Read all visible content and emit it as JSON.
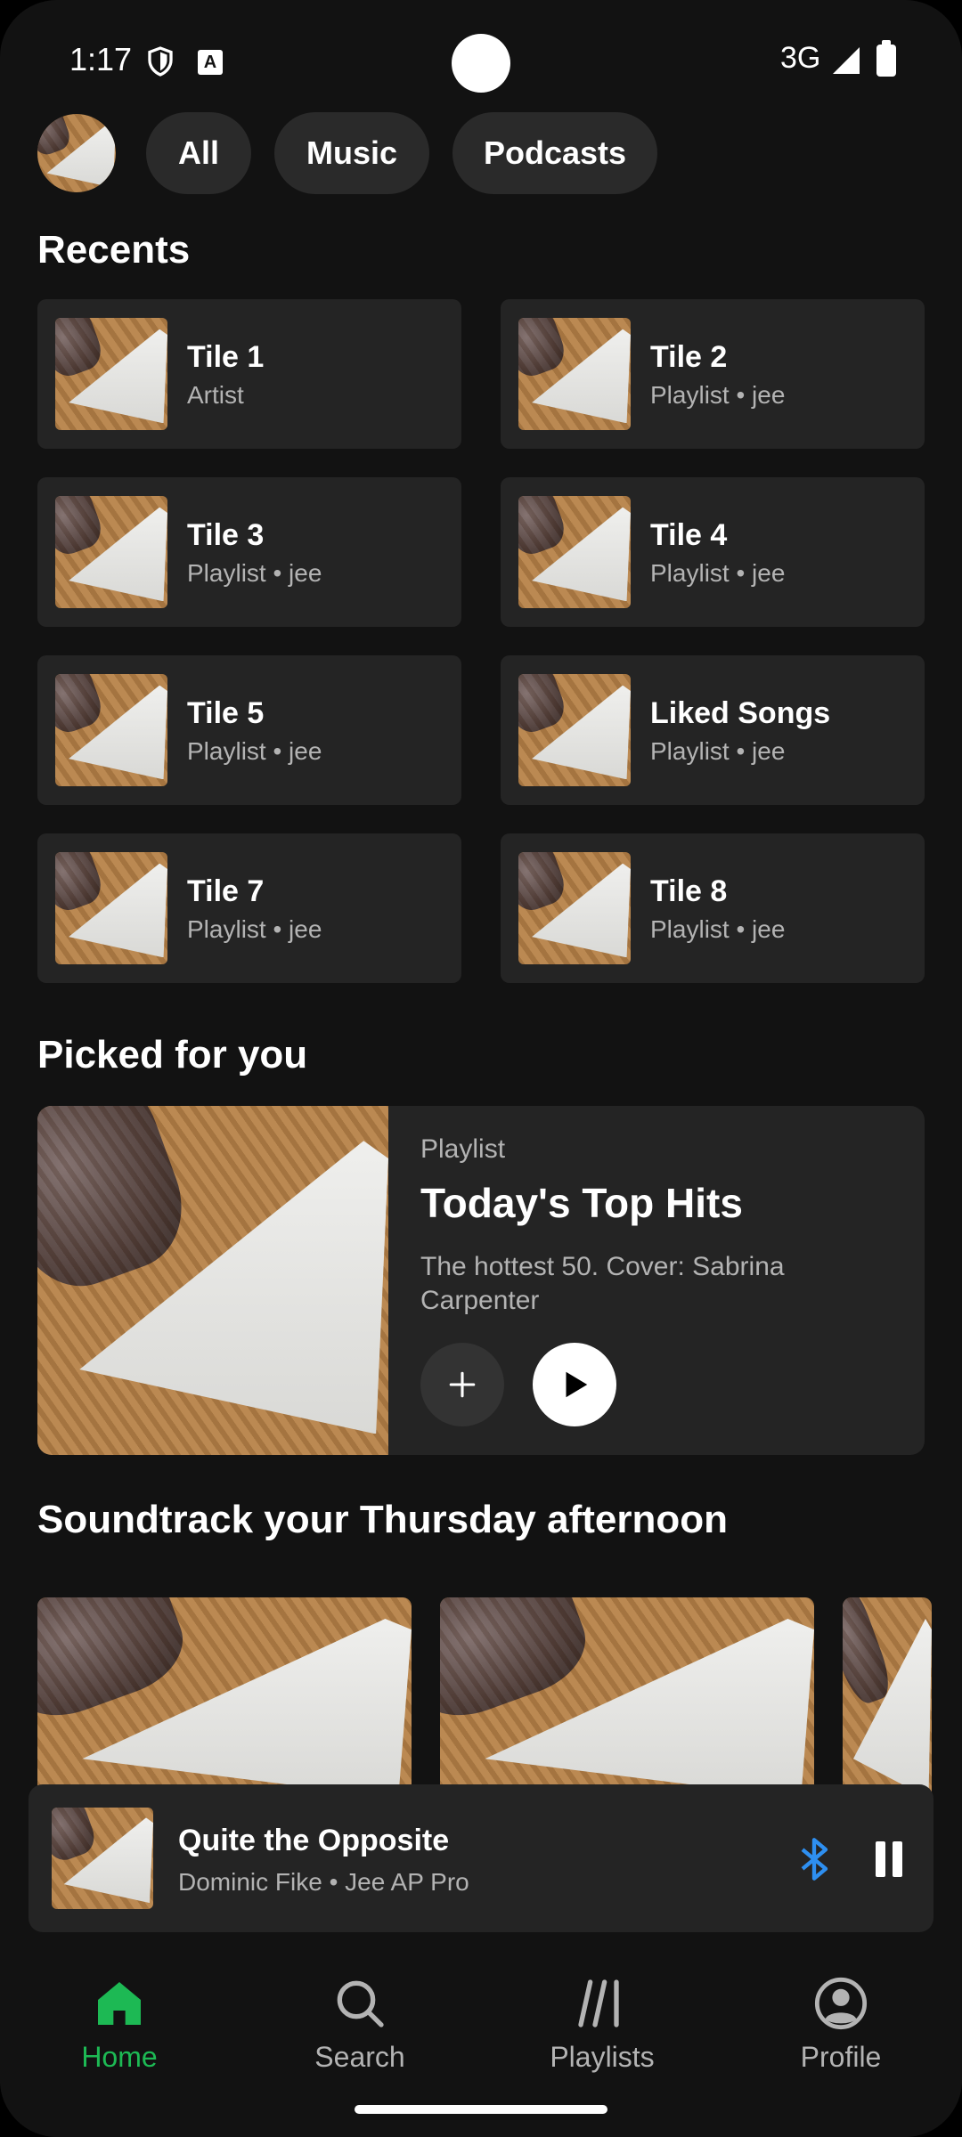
{
  "status_bar": {
    "time": "1:17",
    "network": "3G",
    "keyboard_badge": "A",
    "icons": [
      "shield-icon",
      "keyboard-a-icon",
      "cellular-signal-icon",
      "battery-icon"
    ]
  },
  "filters": {
    "chips": [
      {
        "label": "All"
      },
      {
        "label": "Music"
      },
      {
        "label": "Podcasts"
      }
    ]
  },
  "recents": {
    "title": "Recents",
    "tiles": [
      {
        "title": "Tile 1",
        "subtitle": "Artist"
      },
      {
        "title": "Tile 2",
        "subtitle": "Playlist • jee"
      },
      {
        "title": "Tile 3",
        "subtitle": "Playlist • jee"
      },
      {
        "title": "Tile 4",
        "subtitle": "Playlist • jee"
      },
      {
        "title": "Tile 5",
        "subtitle": "Playlist • jee"
      },
      {
        "title": "Liked Songs",
        "subtitle": "Playlist • jee"
      },
      {
        "title": "Tile 7",
        "subtitle": "Playlist • jee"
      },
      {
        "title": "Tile 8",
        "subtitle": "Playlist • jee"
      }
    ]
  },
  "picked": {
    "section_title": "Picked for you",
    "type": "Playlist",
    "title": "Today's Top Hits",
    "description": "The hottest 50. Cover: Sabrina Carpenter"
  },
  "soundtrack": {
    "section_title": "Soundtrack your Thursday afternoon"
  },
  "now_playing": {
    "title": "Quite the Opposite",
    "subtitle": "Dominic Fike • Jee AP Pro"
  },
  "bottom_nav": {
    "items": [
      {
        "label": "Home",
        "icon": "home-icon",
        "active": true
      },
      {
        "label": "Search",
        "icon": "search-icon"
      },
      {
        "label": "Playlists",
        "icon": "library-icon"
      },
      {
        "label": "Profile",
        "icon": "profile-icon"
      }
    ]
  },
  "colors": {
    "background": "#121212",
    "card": "#242424",
    "chip": "#2a2a2a",
    "accent_green": "#1db954",
    "bluetooth_blue": "#2e8ff0",
    "secondary_text": "#b3b3b3"
  }
}
